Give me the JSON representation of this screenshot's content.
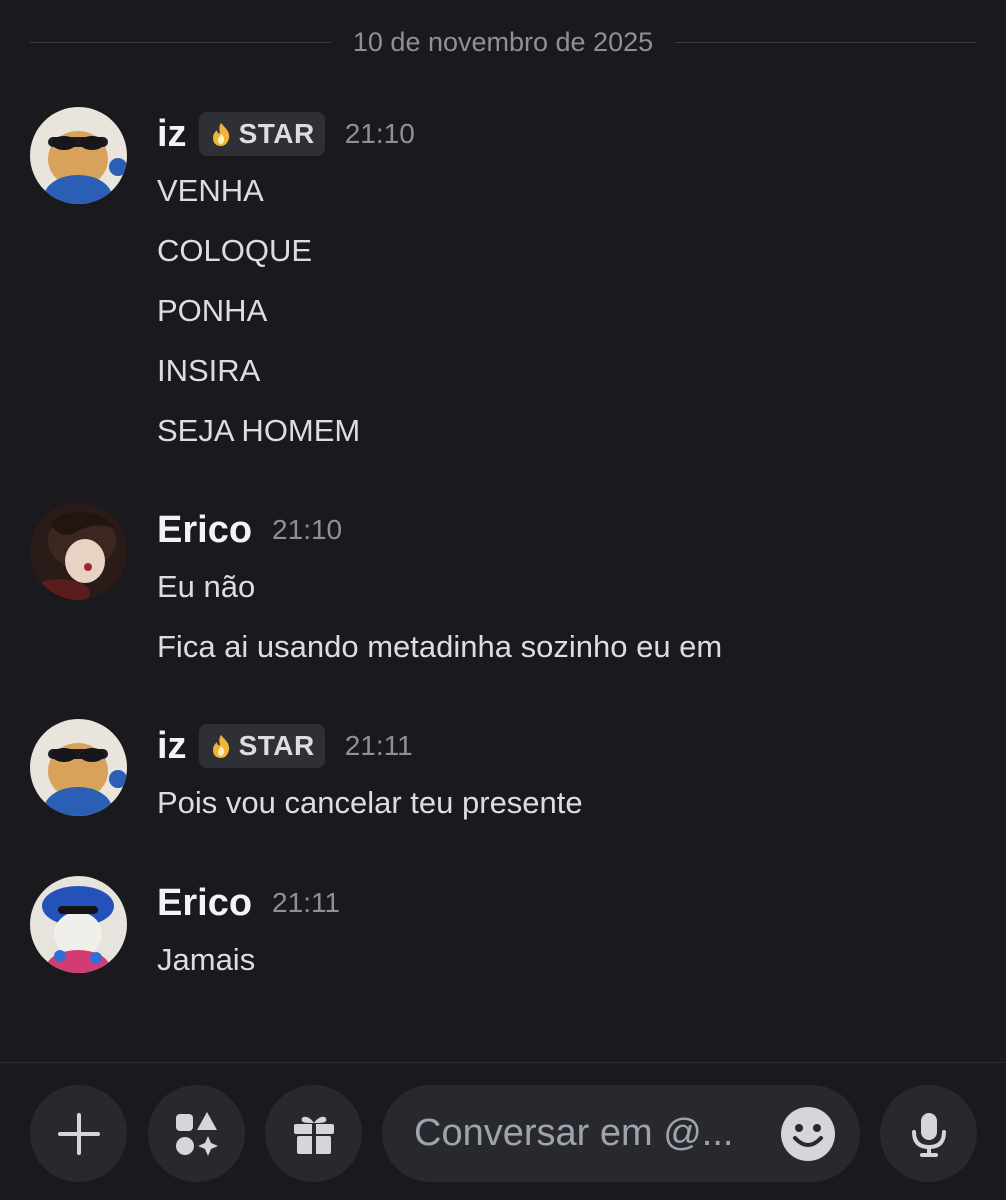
{
  "date_divider": "10 de novembro de 2025",
  "messages": [
    {
      "username": "iz",
      "badge": "STAR",
      "time": "21:10",
      "lines": [
        "VENHA",
        "COLOQUE",
        "PONHA",
        "INSIRA",
        "SEJA HOMEM"
      ]
    },
    {
      "username": "Erico",
      "time": "21:10",
      "lines": [
        "Eu não",
        "Fica ai usando metadinha sozinho eu em"
      ]
    },
    {
      "username": "iz",
      "badge": "STAR",
      "time": "21:11",
      "lines": [
        "Pois vou cancelar teu presente"
      ]
    },
    {
      "username": "Erico",
      "time": "21:11",
      "lines": [
        "Jamais"
      ]
    }
  ],
  "composer": {
    "placeholder": "Conversar em @...",
    "add_icon": "plus-icon",
    "apps_icon": "apps-icon",
    "gift_icon": "gift-icon",
    "emoji_icon": "emoji-icon",
    "mic_icon": "microphone-icon"
  },
  "colors": {
    "background": "#1a1a1e",
    "button_bg": "#28292e",
    "badge_bg": "#2f3035",
    "muted_text": "#8e9099"
  }
}
